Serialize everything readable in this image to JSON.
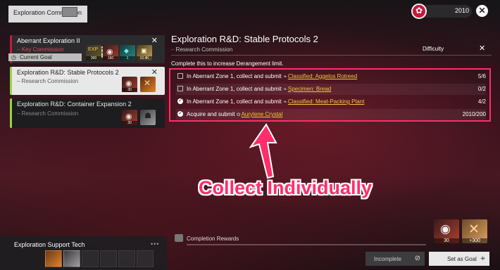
{
  "header": {
    "title": "Exploration Commission",
    "currency_value": "2010"
  },
  "commissions": [
    {
      "title": "Aberrant Exploration II",
      "tag": "Key Commission",
      "goal_label": "Current Goal",
      "rewards": [
        {
          "icon": "exp-item-icon",
          "qty": "300"
        },
        {
          "icon": "meat-item-icon",
          "qty": "160"
        },
        {
          "icon": "crystal-item-icon",
          "qty": "1"
        },
        {
          "icon": "box-item-icon",
          "qty": "10.4K"
        }
      ]
    },
    {
      "title": "Exploration R&D: Stable Protocols 2",
      "tag": "Research Commission",
      "rewards": [
        {
          "icon": "meat-item-icon",
          "qty": "30"
        },
        {
          "icon": "protocol-item-icon",
          "qty": ""
        }
      ]
    },
    {
      "title": "Exploration R&D: Container Expansion 2",
      "tag": "Research Commission",
      "rewards": [
        {
          "icon": "meat-item-icon",
          "qty": "30"
        },
        {
          "icon": "container-item-icon",
          "qty": ""
        }
      ]
    }
  ],
  "detail": {
    "title": "Exploration R&D: Stable Protocols 2",
    "subtitle": "Research Commission",
    "difficulty_label": "Difficulty",
    "description": "Complete this to increase Derangement limit.",
    "tasks": [
      {
        "text": "In Aberrant Zone 1, collect and submit",
        "item": "Classified: Aggelos Rotreed",
        "progress": "5/6",
        "done": false
      },
      {
        "text": "In Aberrant Zone 1, collect and submit",
        "item": "Specimen: Bread",
        "progress": "0/2",
        "done": false
      },
      {
        "text": "In Aberrant Zone 1, collect and submit",
        "item": "Classified: Meat-Packing Plant",
        "progress": "4/2",
        "done": true
      },
      {
        "text": "Acquire and submit",
        "item": "Aurylene Crystal",
        "progress": "2010/200",
        "done": true
      }
    ],
    "annotation": "Collect Individually"
  },
  "rewards": {
    "label": "Completion Rewards",
    "items": [
      {
        "icon": "meat-item-icon",
        "qty": "30"
      },
      {
        "icon": "protocol-item-icon",
        "qty": "+300"
      }
    ]
  },
  "actions": {
    "incomplete_label": "Incomplete",
    "set_goal_label": "Set as Goal"
  },
  "support": {
    "title": "Exploration Support Tech"
  },
  "colors": {
    "accent": "#ff2d6a",
    "link": "#f5c542",
    "key_red": "#c11a3b",
    "research_green": "#9ad341"
  }
}
